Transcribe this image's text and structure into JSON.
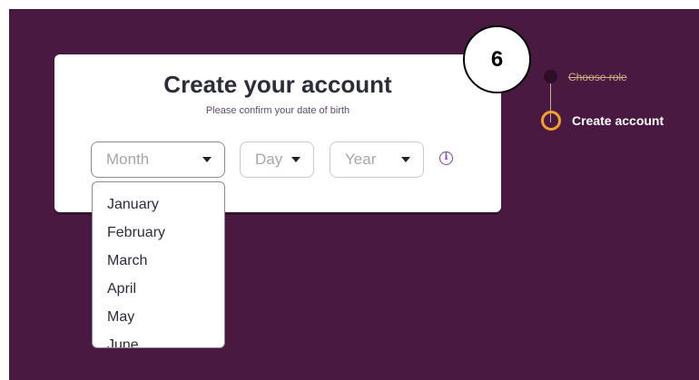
{
  "card": {
    "title": "Create your account",
    "subtitle": "Please confirm your date of birth"
  },
  "form": {
    "month": {
      "placeholder": "Month"
    },
    "day": {
      "placeholder": "Day"
    },
    "year": {
      "placeholder": "Year"
    },
    "info_icon": "info-icon"
  },
  "month_dropdown": {
    "options": [
      "January",
      "February",
      "March",
      "April",
      "May",
      "June"
    ]
  },
  "annotation": {
    "step_number": "6"
  },
  "steps": [
    {
      "label": "Choose role",
      "state": "completed"
    },
    {
      "label": "Create account",
      "state": "active"
    }
  ],
  "colors": {
    "background": "#4a1942",
    "active_step_ring": "#f0a12a",
    "info_accent": "#7b3fb3"
  }
}
